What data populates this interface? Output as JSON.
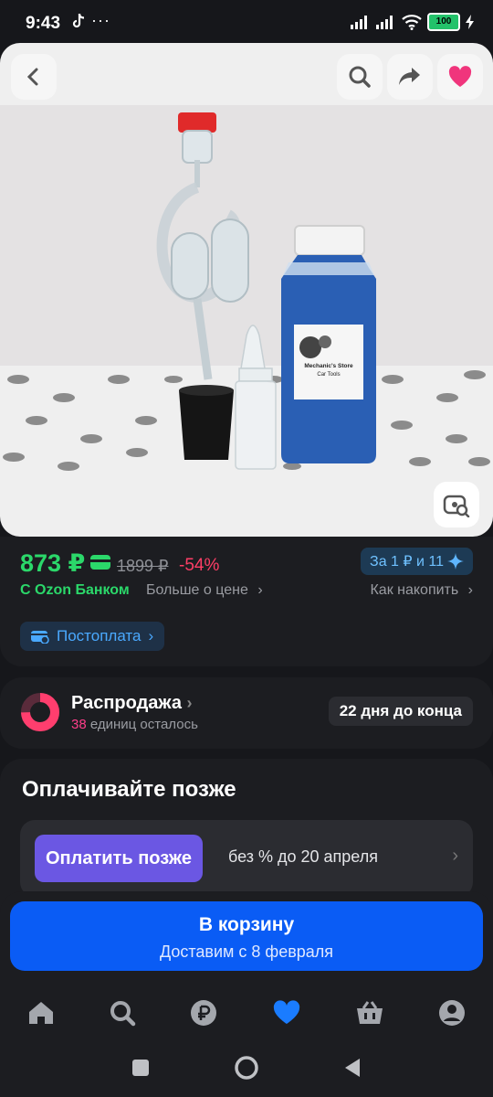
{
  "status": {
    "time": "9:43",
    "dots": "···",
    "battery": "100"
  },
  "price": {
    "current": "873 ₽",
    "old": "1899 ₽",
    "discount": "-54%",
    "bonus": "За 1 ₽ и 11",
    "ozon_bank": "С Ozon Банком",
    "more_price": "Больше о цене",
    "accumulate": "Как накопить",
    "postpay": "Постоплата"
  },
  "sale": {
    "title": "Распродажа",
    "count": "38",
    "subtitle": "единиц осталось",
    "ends": "22 дня до конца"
  },
  "pay_later": {
    "title": "Оплачивайте позже",
    "button": "Оплатить позже",
    "text": "без % до 20 апреля"
  },
  "cart": {
    "title": "В корзину",
    "delivery": "Доставим с 8 февраля"
  },
  "product_image": {
    "label_line1": "Mechanic's Store",
    "label_line2": "Car Tools"
  },
  "nav": [
    "home-icon",
    "search-icon",
    "ruble-icon",
    "favorites-icon",
    "cart-icon",
    "profile-icon"
  ],
  "colors": {
    "accent": "#0a5cf5",
    "price": "#2bd86a",
    "discount": "#ff3e66",
    "paylater": "#6b57e3"
  }
}
